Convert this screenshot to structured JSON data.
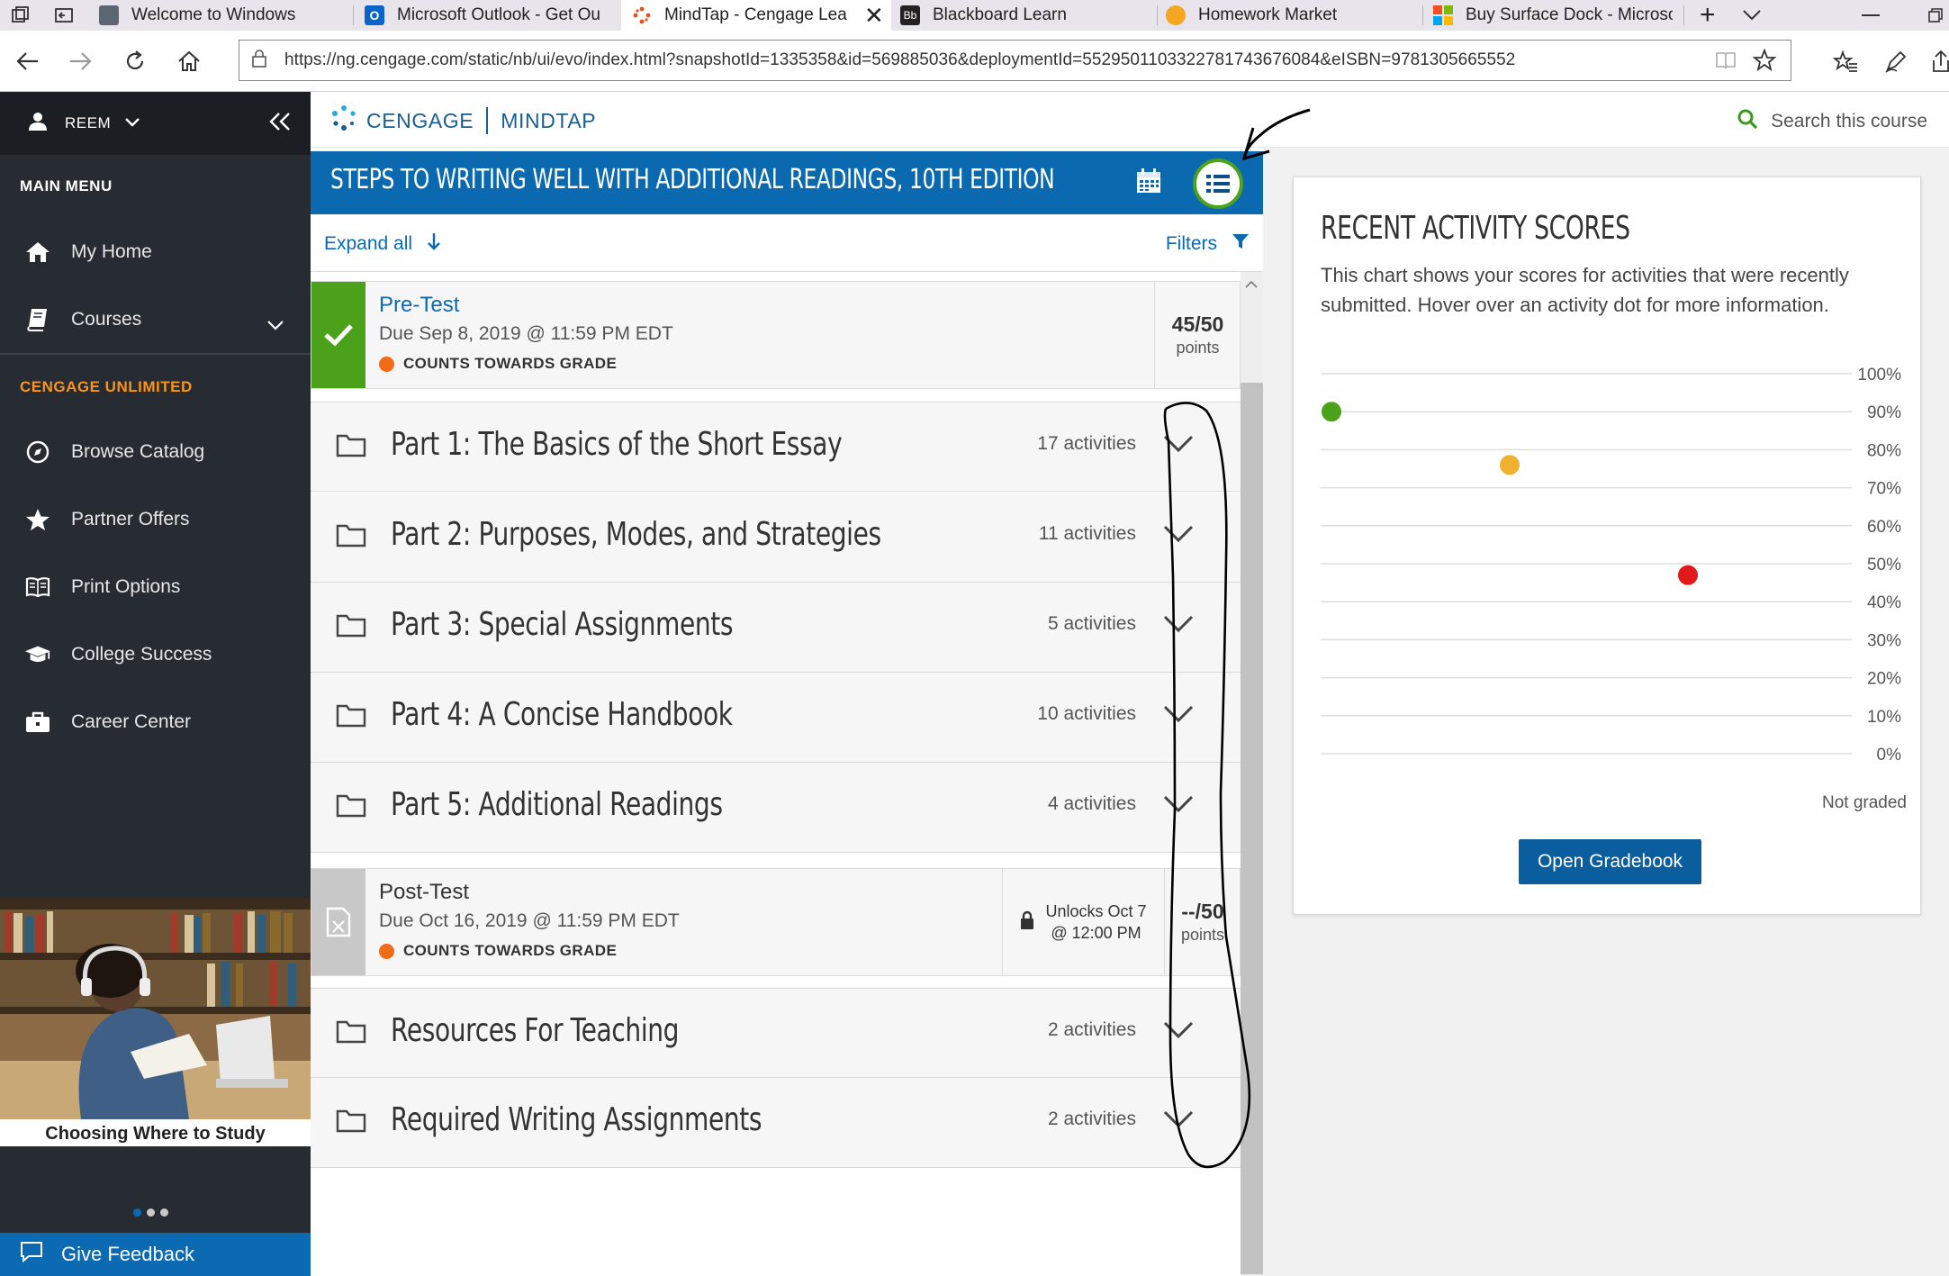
{
  "browser": {
    "tabs": [
      {
        "label": "Welcome to Windows",
        "icon": "windows-welcome-icon",
        "active": false
      },
      {
        "label": "Microsoft Outlook - Get Ou",
        "icon": "outlook-icon",
        "active": false
      },
      {
        "label": "MindTap - Cengage Lea",
        "icon": "cengage-icon",
        "active": true
      },
      {
        "label": "Blackboard Learn",
        "icon": "blackboard-icon",
        "active": false
      },
      {
        "label": "Homework Market",
        "icon": "homework-market-icon",
        "active": false
      },
      {
        "label": "Buy Surface Dock - Microso",
        "icon": "microsoft-icon",
        "active": false
      }
    ],
    "url": "https://ng.cengage.com/static/nb/ui/evo/index.html?snapshotId=1335358&id=569885036&deploymentId=5529501103322781743676084&eISBN=9781305665552"
  },
  "sidebar": {
    "user": "REEM",
    "main_menu_label": "MAIN MENU",
    "main_items": [
      {
        "label": "My Home",
        "icon": "home-icon"
      },
      {
        "label": "Courses",
        "icon": "book-icon"
      }
    ],
    "unlimited_label": "CENGAGE UNLIMITED",
    "unlimited_items": [
      {
        "label": "Browse Catalog",
        "icon": "compass-icon"
      },
      {
        "label": "Partner Offers",
        "icon": "star-icon"
      },
      {
        "label": "Print Options",
        "icon": "open-book-icon"
      },
      {
        "label": "College Success",
        "icon": "graduation-cap-icon"
      },
      {
        "label": "Career Center",
        "icon": "briefcase-icon"
      }
    ],
    "promo_caption": "Choosing Where to Study",
    "feedback_label": "Give Feedback"
  },
  "header": {
    "brand_left": "CENGAGE",
    "brand_right": "MINDTAP",
    "search_label": "Search this course"
  },
  "course": {
    "title": "STEPS TO WRITING WELL WITH ADDITIONAL READINGS, 10TH EDITION",
    "expand_label": "Expand all",
    "filters_label": "Filters",
    "pretest": {
      "name": "Pre-Test",
      "due": "Due Sep 8, 2019 @ 11:59 PM EDT",
      "grade_label": "COUNTS TOWARDS GRADE",
      "score": "45/50",
      "score_unit": "points"
    },
    "units_a": [
      {
        "title": "Part 1: The Basics of the Short Essay",
        "count": "17 activities"
      },
      {
        "title": "Part 2: Purposes, Modes, and Strategies",
        "count": "11 activities"
      },
      {
        "title": "Part 3: Special Assignments",
        "count": "5 activities"
      },
      {
        "title": "Part 4: A Concise Handbook",
        "count": "10 activities"
      },
      {
        "title": "Part 5: Additional Readings",
        "count": "4 activities"
      }
    ],
    "posttest": {
      "name": "Post-Test",
      "due": "Due Oct 16, 2019 @ 11:59 PM EDT",
      "grade_label": "COUNTS TOWARDS GRADE",
      "unlock_line1": "Unlocks Oct 7",
      "unlock_line2": "@ 12:00 PM",
      "score": "--/50",
      "score_unit": "points"
    },
    "units_b": [
      {
        "title": "Resources For Teaching",
        "count": "2 activities"
      },
      {
        "title": "Required Writing Assignments",
        "count": "2 activities"
      }
    ]
  },
  "scores": {
    "title": "RECENT ACTIVITY SCORES",
    "description": "This chart shows your scores for activities that were recently submitted. Hover over an activity dot for more information.",
    "not_graded_label": "Not graded",
    "button_label": "Open Gradebook",
    "colors": {
      "high": "#4ba21a",
      "mid": "#f0b030",
      "low": "#e01a1a"
    }
  },
  "chart_data": {
    "type": "scatter",
    "y_ticks": [
      "100%",
      "90%",
      "80%",
      "70%",
      "60%",
      "50%",
      "40%",
      "30%",
      "20%",
      "10%",
      "0%"
    ],
    "ylim": [
      0,
      100
    ],
    "points": [
      {
        "order": 1,
        "y": 90,
        "color": "#4ba21a"
      },
      {
        "order": 2,
        "y": 76,
        "color": "#f0b030"
      },
      {
        "order": 3,
        "y": 47,
        "color": "#e01a1a"
      }
    ]
  }
}
